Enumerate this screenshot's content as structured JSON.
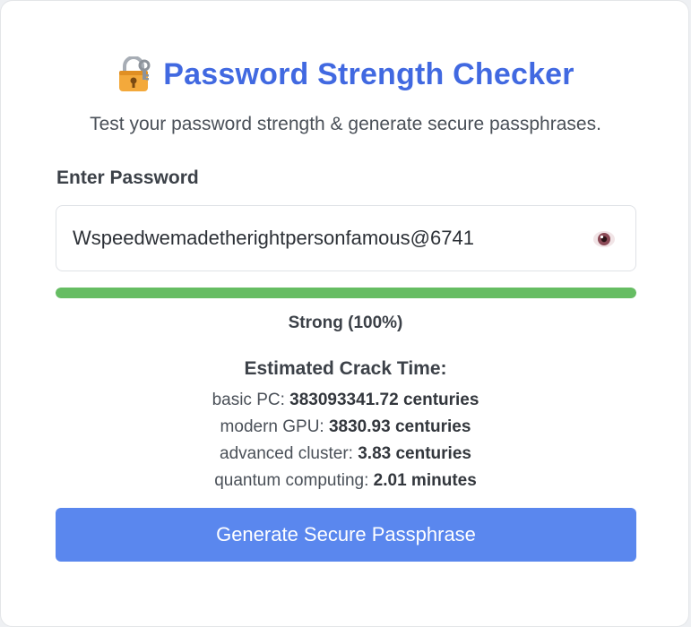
{
  "header": {
    "title": "Password Strength Checker",
    "subtitle": "Test your password strength & generate secure passphrases.",
    "icon": "locked-with-key-icon"
  },
  "password": {
    "label": "Enter Password",
    "value": "Wspeedwemadetherightpersonfamous@6741",
    "toggle_icon": "eye-icon"
  },
  "strength": {
    "percent": 100,
    "text": "Strong (100%)",
    "bar_color": "#66bd63"
  },
  "crack_time": {
    "title": "Estimated Crack Time:",
    "rows": [
      {
        "label": "basic PC:",
        "value": "383093341.72 centuries"
      },
      {
        "label": "modern GPU:",
        "value": "3830.93 centuries"
      },
      {
        "label": "advanced cluster:",
        "value": "3.83 centuries"
      },
      {
        "label": "quantum computing:",
        "value": "2.01 minutes"
      }
    ]
  },
  "actions": {
    "generate_label": "Generate Secure Passphrase"
  },
  "colors": {
    "accent": "#4169e1",
    "button": "#5a87ee"
  }
}
